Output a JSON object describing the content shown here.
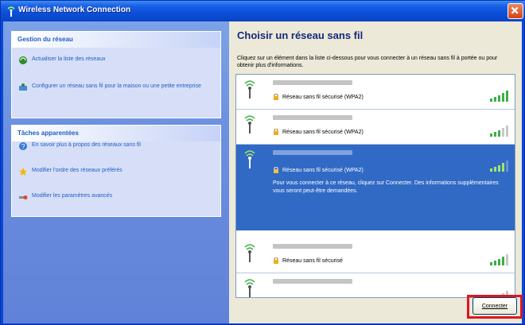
{
  "window": {
    "title": "Wireless Network Connection"
  },
  "taskpane": {
    "network_tasks": {
      "header": "Gestion du réseau",
      "items": [
        {
          "label": "Actualiser la liste des réseaux"
        },
        {
          "label": "Configurer un réseau sans fil pour la maison ou une petite entreprise"
        }
      ]
    },
    "related_tasks": {
      "header": "Tâches apparentées",
      "items": [
        {
          "label": "En savoir plus à propos des réseaux sans fil"
        },
        {
          "label": "Modifier l'ordre des réseaux préférés"
        },
        {
          "label": "Modifier les paramètres avancés"
        }
      ]
    }
  },
  "main": {
    "heading": "Choisir un réseau sans fil",
    "subtitle": "Cliquez sur un élément dans la liste ci-dessous pour vous connecter à un réseau sans fil à portée ou pour obtenir plus d'informations.",
    "networks": [
      {
        "security": "Réseau sans fil sécurisé (WPA2)",
        "signal_level": 5,
        "selected": false
      },
      {
        "security": "Réseau sans fil sécurisé (WPA2)",
        "signal_level": 3,
        "selected": false
      },
      {
        "security": "Réseau sans fil sécurisé (WPA2)",
        "signal_level": 4,
        "selected": true,
        "description": "Pour vous connecter à ce réseau, cliquez sur Connecter. Des informations supplémentaires vous seront peut-être demandées."
      },
      {
        "security": "Réseau sans fil sécurisé",
        "signal_level": 4,
        "selected": false
      },
      {
        "security": "",
        "signal_level": 1,
        "selected": false
      }
    ],
    "connect_label": "Connecter"
  },
  "colors": {
    "accent": "#316ac5",
    "highlight": "#e0151d",
    "title_bar": "#0b4fd9"
  }
}
